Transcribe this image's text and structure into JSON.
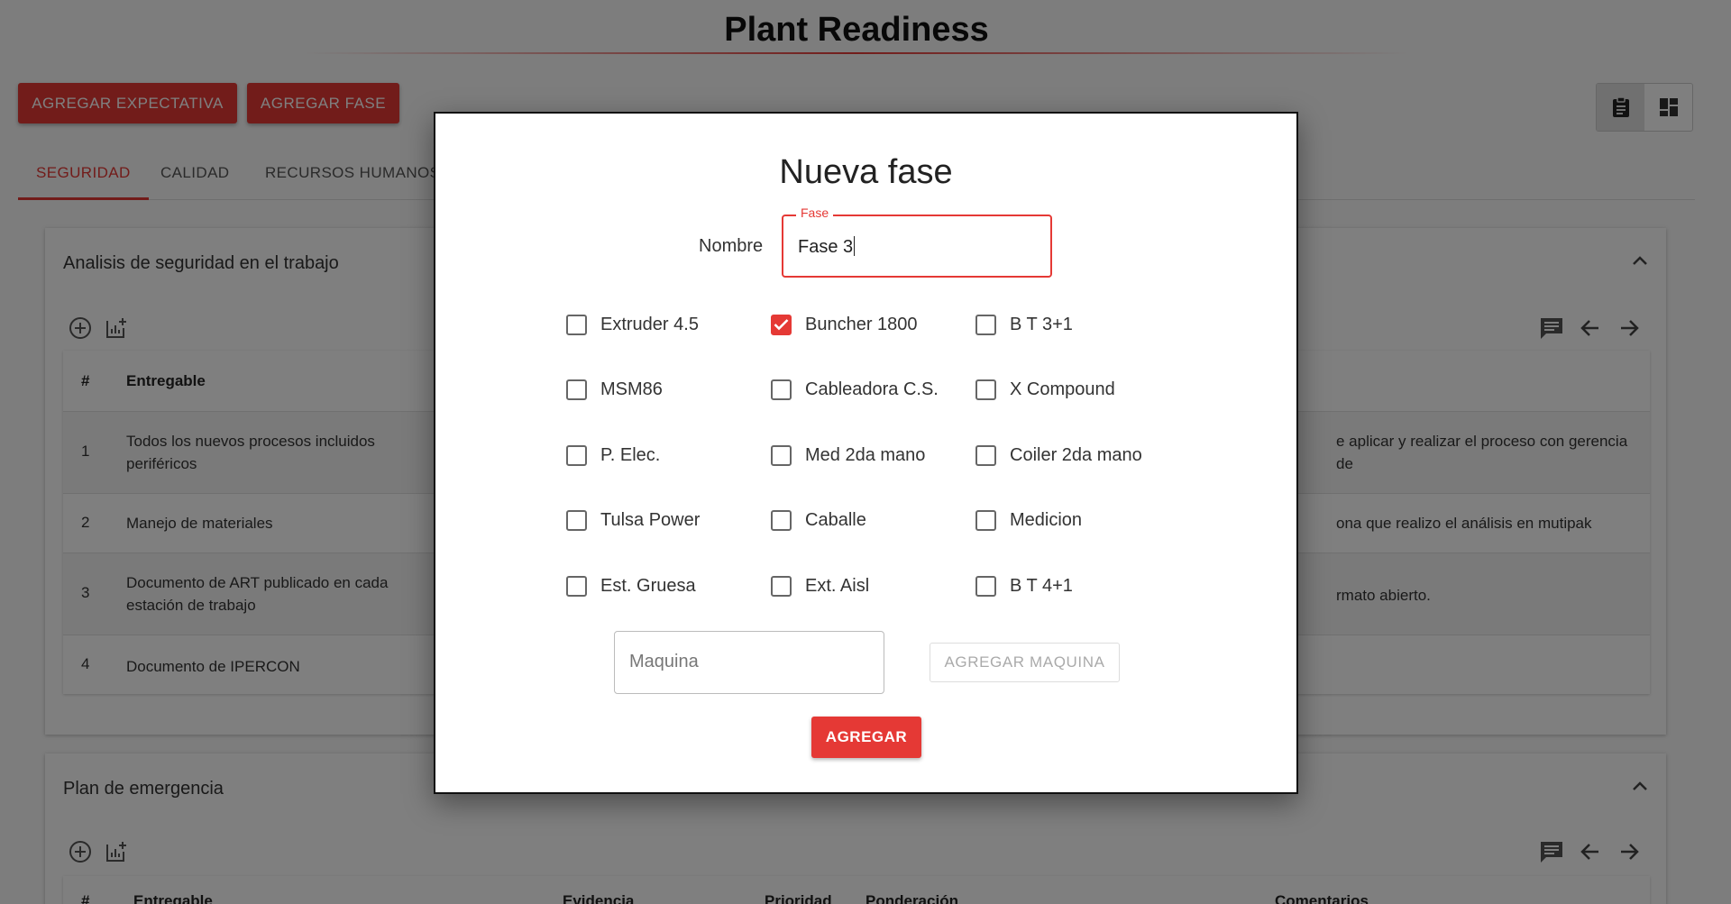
{
  "page": {
    "title": "Plant Readiness",
    "buttons": {
      "add_expectation": "AGREGAR EXPECTATIVA",
      "add_phase": "AGREGAR FASE"
    },
    "view_toggle": [
      {
        "icon": "clipboard-icon",
        "active": true
      },
      {
        "icon": "dashboard-icon",
        "active": false
      }
    ],
    "tabs": [
      "SEGURIDAD",
      "CALIDAD",
      "RECURSOS HUMANOS"
    ],
    "active_tab": "SEGURIDAD"
  },
  "section1": {
    "title": "Analisis de seguridad en el trabajo",
    "headers": [
      "#",
      "Entregable"
    ],
    "rows": [
      {
        "num": "1",
        "text": "Todos los nuevos procesos incluidos periféricos",
        "right": "e aplicar y realizar el proceso con gerencia de"
      },
      {
        "num": "2",
        "text": "Manejo de materiales",
        "right": "ona que realizo el análisis en mutipak"
      },
      {
        "num": "3",
        "text": "Documento de ART publicado en cada estación de trabajo",
        "right": "rmato abierto."
      },
      {
        "num": "4",
        "text": "Documento de IPERCON",
        "right": ""
      }
    ]
  },
  "section2": {
    "title": "Plan de emergencia",
    "headers": [
      "#",
      "Entregable",
      "Evidencia",
      "Prioridad",
      "Ponderación",
      "Comentarios"
    ]
  },
  "dialog": {
    "title": "Nueva fase",
    "nombre_label": "Nombre",
    "fase_legend": "Fase",
    "fase_value": "Fase 3",
    "machines": [
      {
        "label": "Extruder 4.5",
        "checked": false
      },
      {
        "label": "Buncher 1800",
        "checked": true
      },
      {
        "label": "B T 3+1",
        "checked": false
      },
      {
        "label": "MSM86",
        "checked": false
      },
      {
        "label": "Cableadora C.S.",
        "checked": false
      },
      {
        "label": "X Compound",
        "checked": false
      },
      {
        "label": "P. Elec.",
        "checked": false
      },
      {
        "label": "Med 2da mano",
        "checked": false
      },
      {
        "label": "Coiler 2da mano",
        "checked": false
      },
      {
        "label": "Tulsa Power",
        "checked": false
      },
      {
        "label": "Caballe",
        "checked": false
      },
      {
        "label": "Medicion",
        "checked": false
      },
      {
        "label": "Est. Gruesa",
        "checked": false
      },
      {
        "label": "Ext. Aisl",
        "checked": false
      },
      {
        "label": "B T 4+1",
        "checked": false
      }
    ],
    "maquina_placeholder": "Maquina",
    "add_machine_button": "AGREGAR MAQUINA",
    "submit_button": "AGREGAR"
  },
  "colors": {
    "accent": "#e53935",
    "overlay": "rgba(0,0,0,0.5)"
  }
}
